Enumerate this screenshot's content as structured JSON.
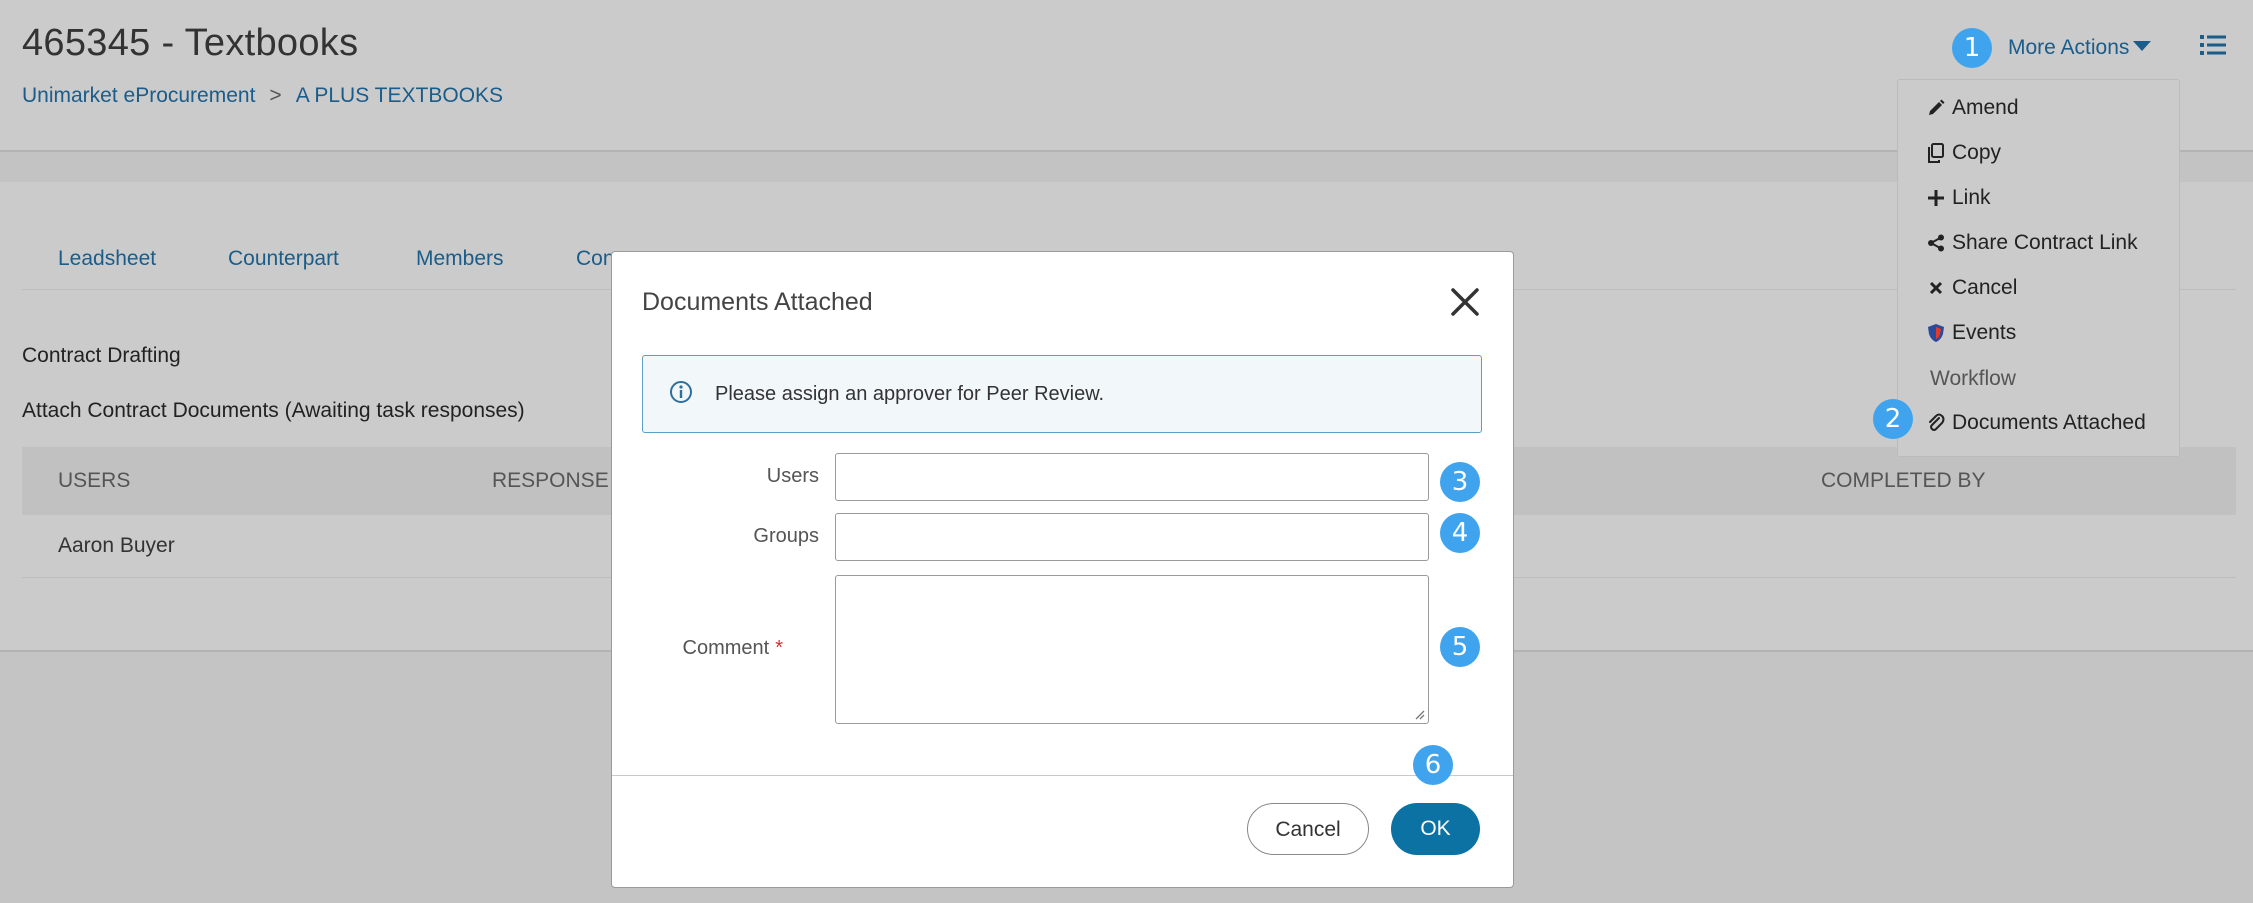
{
  "header": {
    "title": "465345 - Textbooks",
    "breadcrumb": [
      "Unimarket eProcurement",
      "A PLUS TEXTBOOKS"
    ],
    "breadcrumb_separator": ">",
    "more_actions_label": "More Actions"
  },
  "annotations": [
    "1",
    "2",
    "3",
    "4",
    "5",
    "6"
  ],
  "menu": {
    "items": [
      {
        "label": "Amend",
        "icon": "pencil-icon"
      },
      {
        "label": "Copy",
        "icon": "copy-icon"
      },
      {
        "label": "Link",
        "icon": "plus-icon"
      },
      {
        "label": "Share Contract Link",
        "icon": "share-icon"
      },
      {
        "label": "Cancel",
        "icon": "x-icon"
      },
      {
        "label": "Events",
        "icon": "shield-icon"
      },
      {
        "label": "Workflow",
        "icon": null
      },
      {
        "label": "Documents Attached",
        "icon": "paperclip-icon"
      }
    ]
  },
  "tabs": [
    "Leadsheet",
    "Counterpart",
    "Members",
    "Con"
  ],
  "main": {
    "section_title": "Contract Drafting",
    "subsection_title": "Attach Contract Documents (Awaiting task responses)",
    "table": {
      "columns": [
        "USERS",
        "RESPONSE",
        "COMPLETED BY"
      ],
      "rows": [
        [
          "Aaron Buyer",
          "",
          ""
        ]
      ]
    }
  },
  "modal": {
    "title": "Documents Attached",
    "alert_text": "Please assign an approver for Peer Review.",
    "fields": {
      "users_label": "Users",
      "groups_label": "Groups",
      "comment_label": "Comment",
      "required_marker": "*"
    },
    "buttons": {
      "cancel": "Cancel",
      "ok": "OK"
    }
  },
  "colors": {
    "link": "#1a5c8a",
    "badge": "#3fa3ee",
    "primary_button": "#0b72a3",
    "alert_border": "#5b9ec6",
    "required": "#d0312d"
  }
}
